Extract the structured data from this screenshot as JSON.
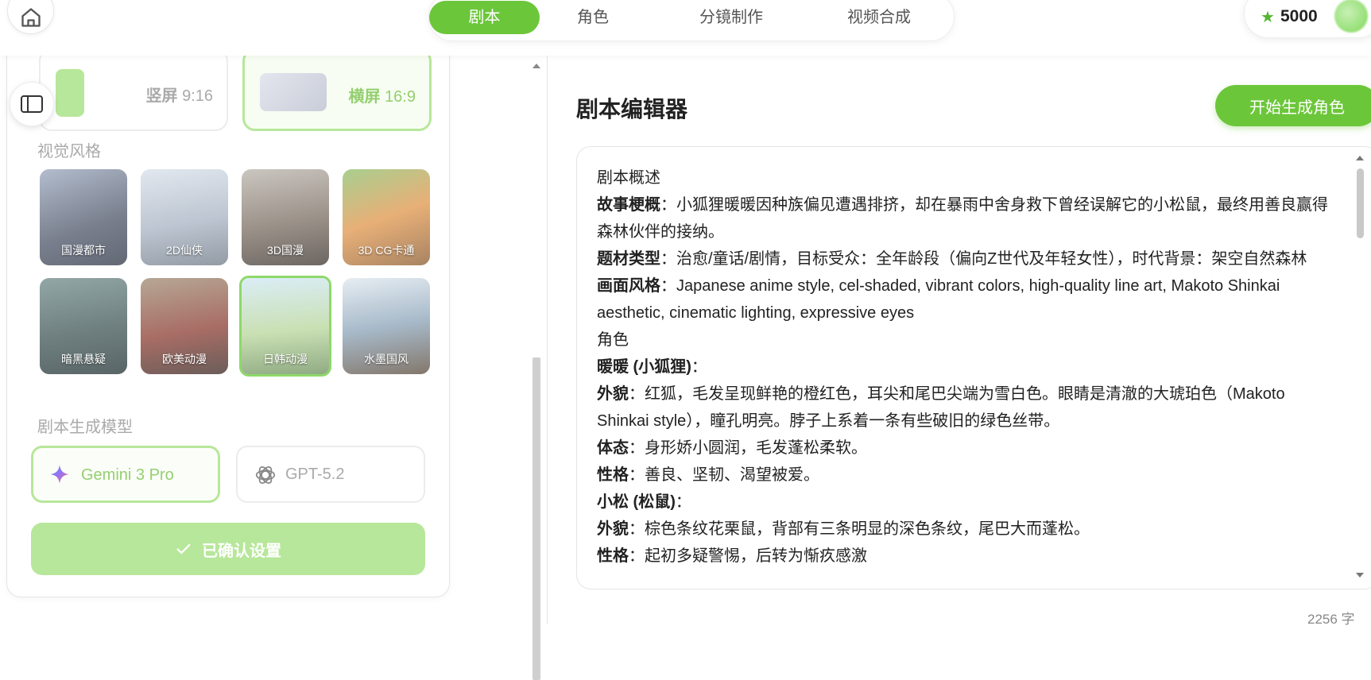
{
  "nav": {
    "tabs": [
      {
        "label": "剧本",
        "active": true
      },
      {
        "label": "角色",
        "active": false
      },
      {
        "label": "分镜制作",
        "active": false
      },
      {
        "label": "视频合成",
        "active": false
      }
    ],
    "credits": "5000",
    "accent_color": "#6cc63a"
  },
  "settings": {
    "ratios": [
      {
        "name": "竖屏",
        "value": "9:16",
        "selected": false
      },
      {
        "name": "横屏",
        "value": "16:9",
        "selected": true
      }
    ],
    "visual_style_label": "视觉风格",
    "styles": [
      {
        "label": "国漫都市",
        "selected": false
      },
      {
        "label": "2D仙侠",
        "selected": false
      },
      {
        "label": "3D国漫",
        "selected": false
      },
      {
        "label": "3D CG卡通",
        "selected": false
      },
      {
        "label": "暗黑悬疑",
        "selected": false
      },
      {
        "label": "欧美动漫",
        "selected": false
      },
      {
        "label": "日韩动漫",
        "selected": true
      },
      {
        "label": "水墨国风",
        "selected": false
      }
    ],
    "model_label": "剧本生成模型",
    "models": [
      {
        "label": "Gemini 3 Pro",
        "icon": "gemini-sparkle-icon",
        "selected": true
      },
      {
        "label": "GPT-5.2",
        "icon": "openai-icon",
        "selected": false
      }
    ],
    "confirm_label": "已确认设置"
  },
  "editor": {
    "title": "剧本编辑器",
    "generate_button": "开始生成角色",
    "lines": [
      {
        "key": "",
        "text": "剧本概述"
      },
      {
        "key": "故事梗概",
        "text": "：小狐狸暖暖因种族偏见遭遇排挤，却在暴雨中舍身救下曾经误解它的小松鼠，最终用善良赢得森林伙伴的接纳。"
      },
      {
        "key": "题材类型",
        "text": "：治愈/童话/剧情，目标受众：全年龄段（偏向Z世代及年轻女性），时代背景：架空自然森林"
      },
      {
        "key": "画面风格",
        "text": "：Japanese anime style, cel-shaded, vibrant colors, high-quality line art, Makoto Shinkai aesthetic, cinematic lighting, expressive eyes"
      },
      {
        "key": "",
        "text": "角色"
      },
      {
        "key": "暖暖 (小狐狸)",
        "text": "："
      },
      {
        "key": "外貌",
        "text": "：红狐，毛发呈现鲜艳的橙红色，耳尖和尾巴尖端为雪白色。眼睛是清澈的大琥珀色（Makoto Shinkai style），瞳孔明亮。脖子上系着一条有些破旧的绿色丝带。"
      },
      {
        "key": "体态",
        "text": "：身形娇小圆润，毛发蓬松柔软。"
      },
      {
        "key": "性格",
        "text": "：善良、坚韧、渴望被爱。"
      },
      {
        "key": "小松 (松鼠)",
        "text": "："
      },
      {
        "key": "外貌",
        "text": "：棕色条纹花栗鼠，背部有三条明显的深色条纹，尾巴大而蓬松。"
      },
      {
        "key": "性格",
        "text": "：起初多疑警惕，后转为惭疚感激"
      }
    ],
    "char_count": "2256 字"
  }
}
